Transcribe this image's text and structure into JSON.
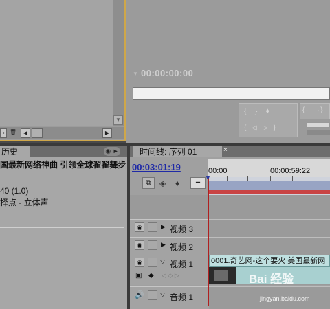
{
  "monitor": {
    "timecode": "00:00:00:00",
    "controls_top": [
      "{",
      "}",
      "♥",
      "{←",
      "→}"
    ],
    "controls_bottom": [
      "{←",
      "◁",
      "▷",
      "→}"
    ]
  },
  "history": {
    "tab_label": "历史",
    "menu_label": "◉ ►",
    "line1": "国最新网络神曲 引领全球翟翟舞步",
    "line2": "40 (1.0)",
    "line3": "择点 - 立体声"
  },
  "timeline": {
    "tab_label": "时间线: 序列 01",
    "close_label": "×",
    "timecode": "00:03:01:19",
    "ruler_labels": [
      "00:00",
      "00:00:59:22"
    ],
    "tracks": [
      {
        "name": "视频 3"
      },
      {
        "name": "视频 2"
      },
      {
        "name": "视频 1"
      },
      {
        "name": "音频 1"
      }
    ],
    "clip_label": "0001.奇艺网-这个要火 美国最新网"
  },
  "watermark": {
    "brand": "Bai 经验",
    "url": "jingyan.baidu.com"
  }
}
